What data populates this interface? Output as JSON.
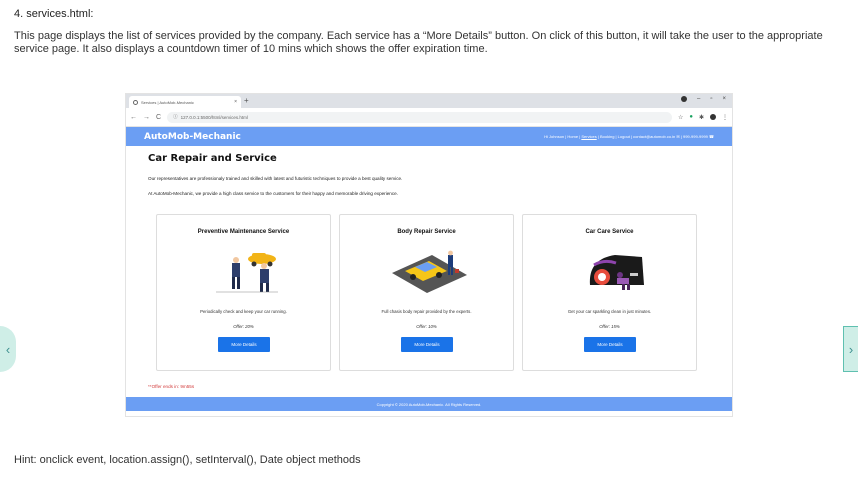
{
  "doc": {
    "heading": "4. services.html:",
    "description": "This page displays the list of services provided by the company. Each service has a “More Details” button. On click of this button, it will take the user to the appropriate service page. It also displays a countdown timer of 10 mins which shows the offer expiration time.",
    "hint": "Hint: onclick event, location.assign(), setInterval(), Date object methods"
  },
  "browser": {
    "tab_title": "Services | AutoMob-Mechanic",
    "tab_close": "×",
    "new_tab": "+",
    "url": "127.0.0.1:5500/html/services.html",
    "back": "←",
    "forward": "→",
    "reload": "C",
    "minimize": "–",
    "maximize": "▫",
    "close": "×",
    "star": "☆",
    "menu": "⋮"
  },
  "site": {
    "brand": "AutoMob-Mechanic",
    "nav_pre": "Hi Johnson | Home | ",
    "nav_services": "Services",
    "nav_post": " | Booking | Logout | contact@automob.co.in ✉ | 999-999-9999 ☎",
    "page_title": "Car Repair and Service",
    "intro1": "Our representatives are professionaly trained and skilled with latest and futuristic techniques to provide a best quality service.",
    "intro2": "At AutoMob-Mechanic, we provide a high class service to the customers for their happy and memorable driving experience.",
    "countdown_label": "**Offer ends in: ",
    "countdown_value": "9m55s",
    "footer": "Copyright © 2020 AutoMob-Mechanic.  All Rights Reserved."
  },
  "services": [
    {
      "title": "Preventive Maintenance Service",
      "desc": "Periodically check and keep your car running.",
      "offer": "Offer: 20%",
      "button": "More Details"
    },
    {
      "title": "Body Repair Service",
      "desc": "Full chasis body repair provided by the experts.",
      "offer": "Offer: 10%",
      "button": "More Details"
    },
    {
      "title": "Car Care Service",
      "desc": "Get your car sparkling clean in just minutes.",
      "offer": "Offer: 15%",
      "button": "More Details"
    }
  ],
  "carousel": {
    "prev": "‹",
    "next": "›"
  },
  "colors": {
    "nav": "#6b9ef3",
    "button": "#1a73e8",
    "countdown": "#d23a3a"
  }
}
